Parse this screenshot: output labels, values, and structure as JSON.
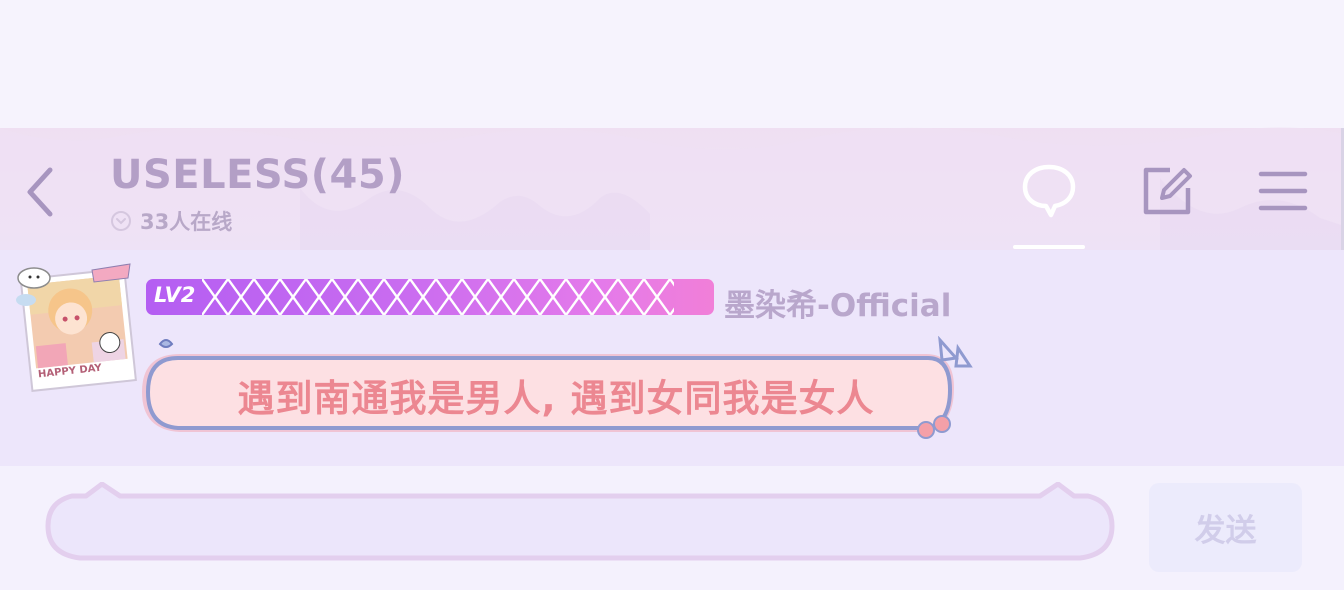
{
  "header": {
    "title": "USELESS(45)",
    "online_text": "33人在线",
    "back_icon": "chevron-left-icon",
    "chat_icon": "chat-bubble-icon",
    "edit_icon": "edit-square-icon",
    "menu_icon": "hamburger-menu-icon"
  },
  "message": {
    "level_label": "LV2",
    "username": "墨染希-Official",
    "text": "遇到南通我是男人, 遇到女同我是女人",
    "avatar_caption": "HAPPY DAY"
  },
  "composer": {
    "input_value": "",
    "send_label": "发送"
  },
  "colors": {
    "title": "#b39fc6",
    "level_bar_start": "#b45ef2",
    "level_bar_end": "#f17fd8",
    "bubble_text": "#ec8791",
    "bubble_border": "#8f9ad0",
    "send_button_bg": "#ecebfc"
  }
}
